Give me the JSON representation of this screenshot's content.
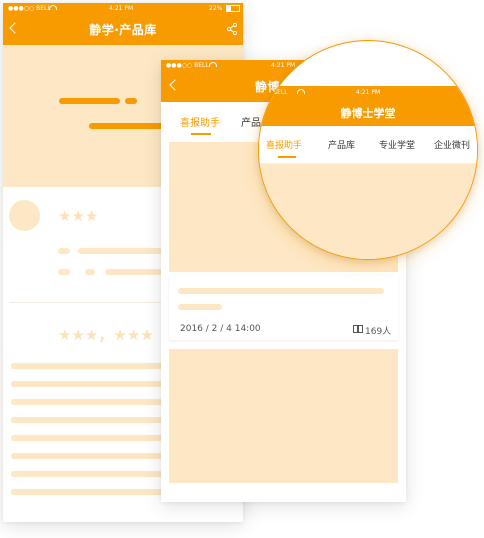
{
  "back_phone": {
    "status": {
      "carrier": "●●●○○ BELL",
      "time": "4:21 PM",
      "battery": "22%"
    },
    "title": "静学·产品库",
    "rating_placeholder": "★★★",
    "review_placeholder": "★★★，★★★"
  },
  "front_phone": {
    "status": {
      "carrier": "●●●○○ BELL",
      "time": "4:21 PM"
    },
    "title": "静博",
    "tabs": [
      "喜报助手",
      "产品"
    ],
    "card": {
      "date": "2016 / 2 / 4  14:00",
      "views": "169人"
    }
  },
  "zoom": {
    "status": {
      "carrier": "BELL",
      "time": "4:21 PM"
    },
    "title": "静博士学堂",
    "tabs": [
      "喜报助手",
      "产品库",
      "专业学堂",
      "企业微刊"
    ],
    "active_tab": 0
  },
  "colors": {
    "accent": "#f89b00",
    "placeholder": "#fde7c4"
  },
  "icons": [
    "back-icon",
    "share-icon",
    "wifi-icon",
    "battery-icon",
    "book-icon"
  ]
}
